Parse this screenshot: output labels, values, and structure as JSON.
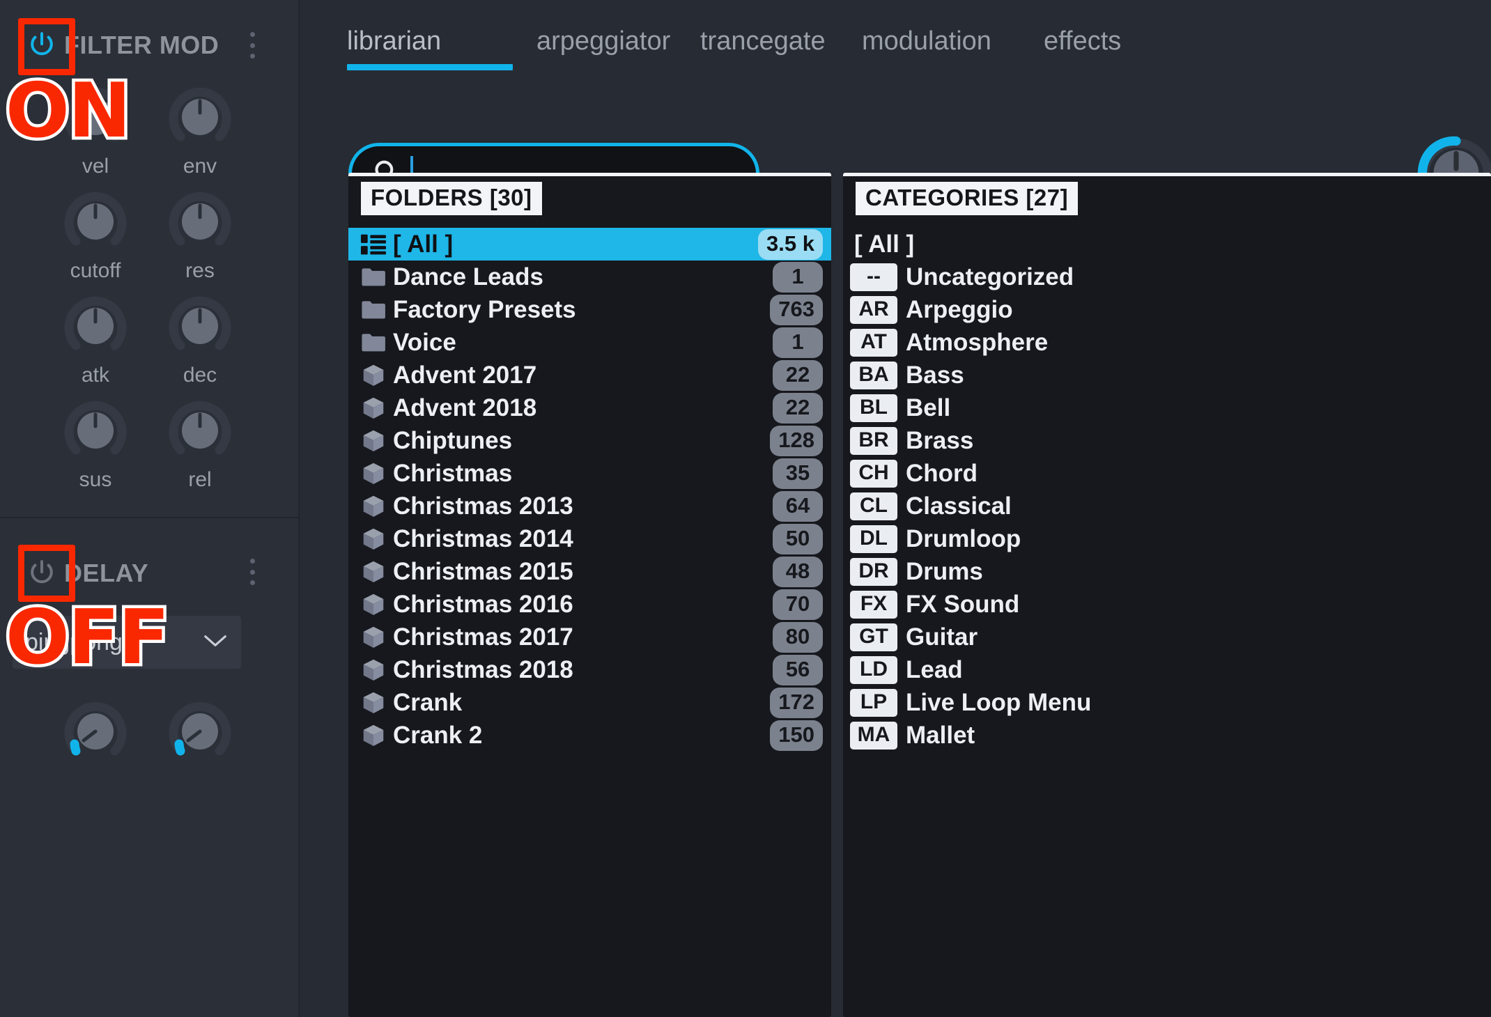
{
  "sidebar": {
    "filter_mod": {
      "title": "FILTER MOD",
      "power_icon": "power-icon",
      "power_state": "on",
      "menu_icon": "kebab-menu-icon",
      "knobs": [
        {
          "label": "vel"
        },
        {
          "label": "env"
        },
        {
          "label": "cutoff"
        },
        {
          "label": "res"
        },
        {
          "label": "atk"
        },
        {
          "label": "dec"
        },
        {
          "label": "sus"
        },
        {
          "label": "rel"
        }
      ]
    },
    "delay": {
      "title": "DELAY",
      "power_icon": "power-icon",
      "power_state": "off",
      "menu_icon": "kebab-menu-icon",
      "mode": "pingpong",
      "mode_chevron_icon": "chevron-down-icon"
    }
  },
  "annotations": [
    {
      "id": "filter-mod-power",
      "label": "ON"
    },
    {
      "id": "delay-power",
      "label": "OFF"
    }
  ],
  "tabs": [
    {
      "label": "librarian",
      "active": true
    },
    {
      "label": "arpeggiator",
      "active": false
    },
    {
      "label": "trancegate",
      "active": false
    },
    {
      "label": "modulation",
      "active": false
    },
    {
      "label": "effects",
      "active": false
    }
  ],
  "search": {
    "icon": "search-icon",
    "value": "",
    "placeholder": ""
  },
  "folders_panel": {
    "header": "FOLDERS [30]",
    "rows": [
      {
        "icon": "list-all-icon",
        "label": "[ All ]",
        "count": "3.5 k",
        "selected": true
      },
      {
        "icon": "folder-icon",
        "label": "Dance Leads",
        "count": "1",
        "selected": false
      },
      {
        "icon": "folder-icon",
        "label": "Factory Presets",
        "count": "763",
        "selected": false
      },
      {
        "icon": "folder-icon",
        "label": "Voice",
        "count": "1",
        "selected": false
      },
      {
        "icon": "bank-cube-icon",
        "label": "Advent 2017",
        "count": "22",
        "selected": false
      },
      {
        "icon": "bank-cube-icon",
        "label": "Advent 2018",
        "count": "22",
        "selected": false
      },
      {
        "icon": "bank-cube-icon",
        "label": "Chiptunes",
        "count": "128",
        "selected": false
      },
      {
        "icon": "bank-cube-icon",
        "label": "Christmas",
        "count": "35",
        "selected": false
      },
      {
        "icon": "bank-cube-icon",
        "label": "Christmas 2013",
        "count": "64",
        "selected": false
      },
      {
        "icon": "bank-cube-icon",
        "label": "Christmas 2014",
        "count": "50",
        "selected": false
      },
      {
        "icon": "bank-cube-icon",
        "label": "Christmas 2015",
        "count": "48",
        "selected": false
      },
      {
        "icon": "bank-cube-icon",
        "label": "Christmas 2016",
        "count": "70",
        "selected": false
      },
      {
        "icon": "bank-cube-icon",
        "label": "Christmas 2017",
        "count": "80",
        "selected": false
      },
      {
        "icon": "bank-cube-icon",
        "label": "Christmas 2018",
        "count": "56",
        "selected": false
      },
      {
        "icon": "bank-cube-icon",
        "label": "Crank",
        "count": "172",
        "selected": false
      },
      {
        "icon": "bank-cube-icon",
        "label": "Crank 2",
        "count": "150",
        "selected": false
      }
    ]
  },
  "categories_panel": {
    "header": "CATEGORIES [27]",
    "all_label": "[ All ]",
    "rows": [
      {
        "tag": "--",
        "label": "Uncategorized"
      },
      {
        "tag": "AR",
        "label": "Arpeggio"
      },
      {
        "tag": "AT",
        "label": "Atmosphere"
      },
      {
        "tag": "BA",
        "label": "Bass"
      },
      {
        "tag": "BL",
        "label": "Bell"
      },
      {
        "tag": "BR",
        "label": "Brass"
      },
      {
        "tag": "CH",
        "label": "Chord"
      },
      {
        "tag": "CL",
        "label": "Classical"
      },
      {
        "tag": "DL",
        "label": "Drumloop"
      },
      {
        "tag": "DR",
        "label": "Drums"
      },
      {
        "tag": "FX",
        "label": "FX Sound"
      },
      {
        "tag": "GT",
        "label": "Guitar"
      },
      {
        "tag": "LD",
        "label": "Lead"
      },
      {
        "tag": "LP",
        "label": "Live Loop Menu"
      },
      {
        "tag": "MA",
        "label": "Mallet"
      }
    ]
  },
  "colors": {
    "accent": "#11b4ea",
    "selected_row": "#1fb6e8",
    "annotation": "#fa2800",
    "panel_bg": "#16181d",
    "sidebar_bg": "#2b2f38",
    "main_bg": "#272b33"
  }
}
